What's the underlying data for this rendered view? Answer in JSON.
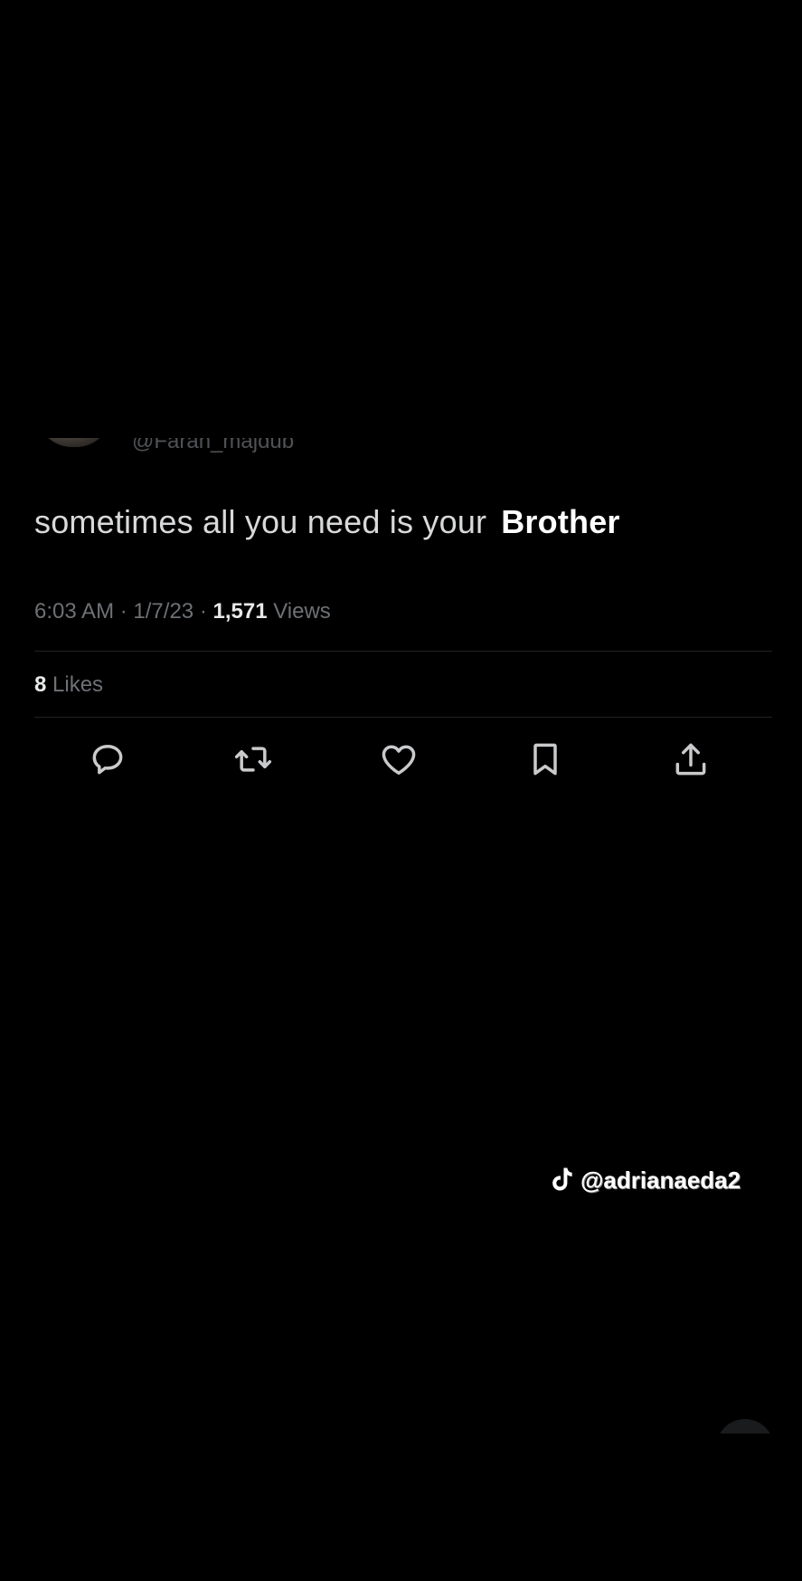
{
  "tweet": {
    "handle": "@Farah_majdub",
    "text_regular": "sometimes all you need is your",
    "text_bold": "Brother",
    "meta": {
      "time": "6:03 AM",
      "separator": "·",
      "date": "1/7/23",
      "views_count": "1,571",
      "views_label": "Views"
    },
    "likes": {
      "count": "8",
      "label": "Likes"
    },
    "actions": [
      {
        "name": "reply",
        "icon": "reply-icon"
      },
      {
        "name": "retweet",
        "icon": "retweet-icon"
      },
      {
        "name": "like",
        "icon": "heart-icon"
      },
      {
        "name": "bookmark",
        "icon": "bookmark-icon"
      },
      {
        "name": "share",
        "icon": "share-icon"
      }
    ]
  },
  "watermark": {
    "icon": "tiktok-icon",
    "text": "@adrianaeda2"
  },
  "colors": {
    "background": "#000000",
    "primary_text": "#e7e9ea",
    "secondary_text": "#6d7175",
    "divider": "#1f2226"
  }
}
